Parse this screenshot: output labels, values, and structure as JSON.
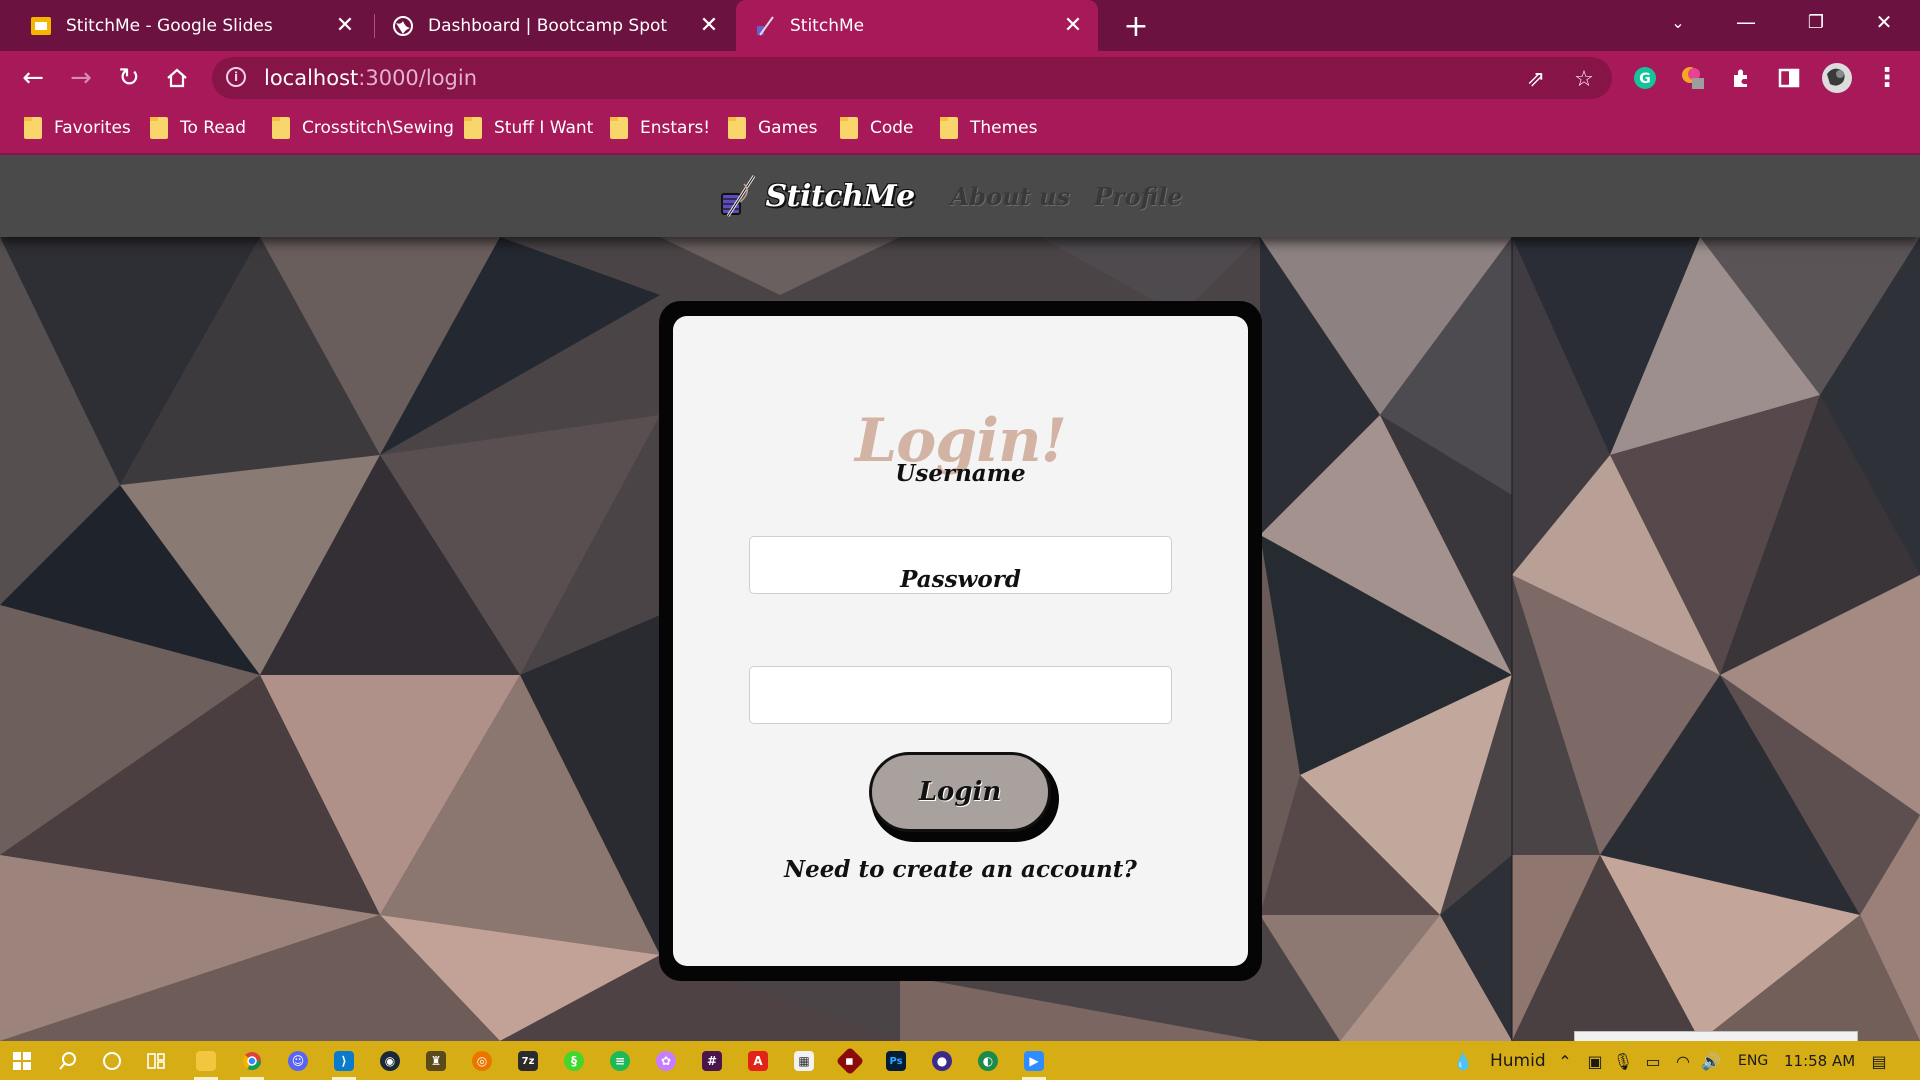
{
  "browser": {
    "tabs": [
      {
        "title": "StitchMe - Google Slides",
        "favicon": "google-slides-icon",
        "active": false
      },
      {
        "title": "Dashboard | Bootcamp Spot",
        "favicon": "globe-icon",
        "active": false
      },
      {
        "title": "StitchMe",
        "favicon": "stitchme-favicon",
        "active": true
      }
    ],
    "url": {
      "host": "localhost",
      "path": ":3000/login"
    },
    "bookmarks": [
      "Favorites",
      "To Read",
      "Crosstitch\\Sewing",
      "Stuff I Want",
      "Enstars!",
      "Games",
      "Code",
      "Themes"
    ],
    "colors": {
      "tab_strip": "#6c1240",
      "toolbar": "#a8195a",
      "omnibox": "#861447"
    }
  },
  "site": {
    "brand": "StitchMe",
    "nav": [
      "About us",
      "Profile"
    ],
    "colors": {
      "header": "#4b4a4a",
      "title_accent": "#d3b4a4",
      "button": "#a9a19e"
    }
  },
  "login": {
    "title": "Login!",
    "username_label": "Username",
    "username_value": "",
    "password_label": "Password",
    "password_value": "",
    "submit_label": "Login",
    "signup_link": "Need to create an account?"
  },
  "taskbar": {
    "apps": [
      "start-icon",
      "search-icon",
      "cortana-icon",
      "task-view-icon",
      "file-explorer-icon",
      "chrome-icon",
      "discord-icon",
      "vscode-icon",
      "steam-icon",
      "app-icon",
      "blender-icon",
      "terminal-icon",
      "razer-icon",
      "spotify-icon",
      "colorful-icon",
      "slack-icon",
      "acrobat-icon",
      "paint-icon",
      "git-icon",
      "photoshop-icon",
      "firefox-icon",
      "circle-app-icon",
      "zoom-icon"
    ],
    "weather": "Humid",
    "language": "ENG",
    "time": "11:58 AM"
  }
}
